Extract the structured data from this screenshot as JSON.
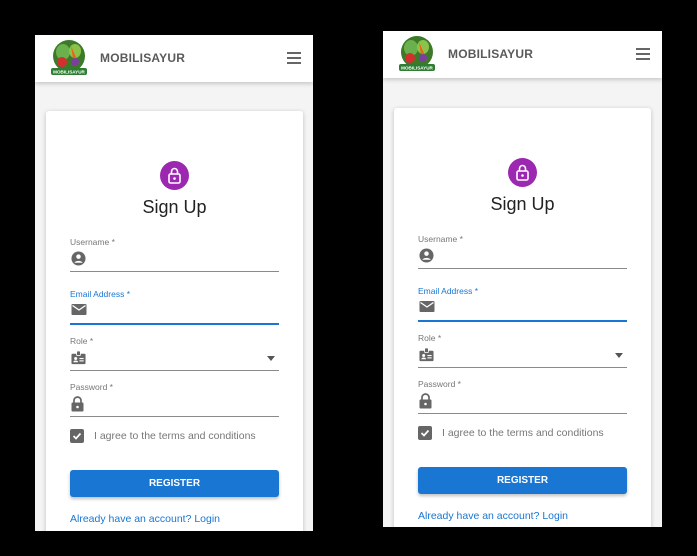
{
  "app": {
    "brand": "MOBILISAYUR",
    "logo_text": "MOBILISAYUR"
  },
  "form": {
    "title": "Sign Up",
    "username_label": "Username *",
    "email_label": "Email Address *",
    "role_label": "Role *",
    "password_label": "Password *",
    "agree_label": "I agree to the terms and conditions",
    "agree_checked": true,
    "register_label": "REGISTER",
    "login_link": "Already have an account? Login"
  },
  "colors": {
    "accent": "#1976d2",
    "lock_avatar": "#9c27b0"
  },
  "icons": [
    "menu-icon",
    "lock-icon",
    "account-circle-icon",
    "email-icon",
    "badge-icon",
    "password-lock-icon",
    "check-icon",
    "dropdown-arrow-icon"
  ]
}
